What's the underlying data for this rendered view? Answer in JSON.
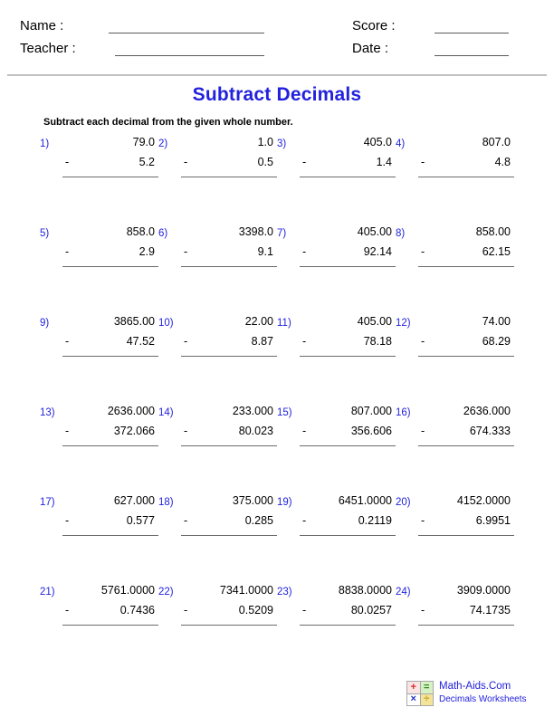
{
  "header": {
    "name_label": "Name :",
    "teacher_label": "Teacher :",
    "score_label": "Score :",
    "date_label": "Date :",
    "name_value": "",
    "teacher_value": "",
    "score_value": "",
    "date_value": ""
  },
  "title": "Subtract Decimals",
  "instruction": "Subtract each decimal from the given whole number.",
  "operator": "-",
  "accent_color": "#2222dd",
  "rule_color": "#6b6b6b",
  "problems": [
    {
      "index": "1)",
      "minuend": "79.0",
      "subtrahend": "5.2"
    },
    {
      "index": "2)",
      "minuend": "1.0",
      "subtrahend": "0.5"
    },
    {
      "index": "3)",
      "minuend": "405.0",
      "subtrahend": "1.4"
    },
    {
      "index": "4)",
      "minuend": "807.0",
      "subtrahend": "4.8"
    },
    {
      "index": "5)",
      "minuend": "858.0",
      "subtrahend": "2.9"
    },
    {
      "index": "6)",
      "minuend": "3398.0",
      "subtrahend": "9.1"
    },
    {
      "index": "7)",
      "minuend": "405.00",
      "subtrahend": "92.14"
    },
    {
      "index": "8)",
      "minuend": "858.00",
      "subtrahend": "62.15"
    },
    {
      "index": "9)",
      "minuend": "3865.00",
      "subtrahend": "47.52"
    },
    {
      "index": "10)",
      "minuend": "22.00",
      "subtrahend": "8.87"
    },
    {
      "index": "11)",
      "minuend": "405.00",
      "subtrahend": "78.18"
    },
    {
      "index": "12)",
      "minuend": "74.00",
      "subtrahend": "68.29"
    },
    {
      "index": "13)",
      "minuend": "2636.000",
      "subtrahend": "372.066"
    },
    {
      "index": "14)",
      "minuend": "233.000",
      "subtrahend": "80.023"
    },
    {
      "index": "15)",
      "minuend": "807.000",
      "subtrahend": "356.606"
    },
    {
      "index": "16)",
      "minuend": "2636.000",
      "subtrahend": "674.333"
    },
    {
      "index": "17)",
      "minuend": "627.000",
      "subtrahend": "0.577"
    },
    {
      "index": "18)",
      "minuend": "375.000",
      "subtrahend": "0.285"
    },
    {
      "index": "19)",
      "minuend": "6451.0000",
      "subtrahend": "0.2119"
    },
    {
      "index": "20)",
      "minuend": "4152.0000",
      "subtrahend": "6.9951"
    },
    {
      "index": "21)",
      "minuend": "5761.0000",
      "subtrahend": "0.7436"
    },
    {
      "index": "22)",
      "minuend": "7341.0000",
      "subtrahend": "0.5209"
    },
    {
      "index": "23)",
      "minuend": "8838.0000",
      "subtrahend": "80.0257"
    },
    {
      "index": "24)",
      "minuend": "3909.0000",
      "subtrahend": "74.1735"
    }
  ],
  "footer": {
    "brand": "Math-Aids.Com",
    "subtitle": "Decimals Worksheets",
    "logo_cells": [
      "+",
      "=",
      "×",
      "÷"
    ]
  }
}
